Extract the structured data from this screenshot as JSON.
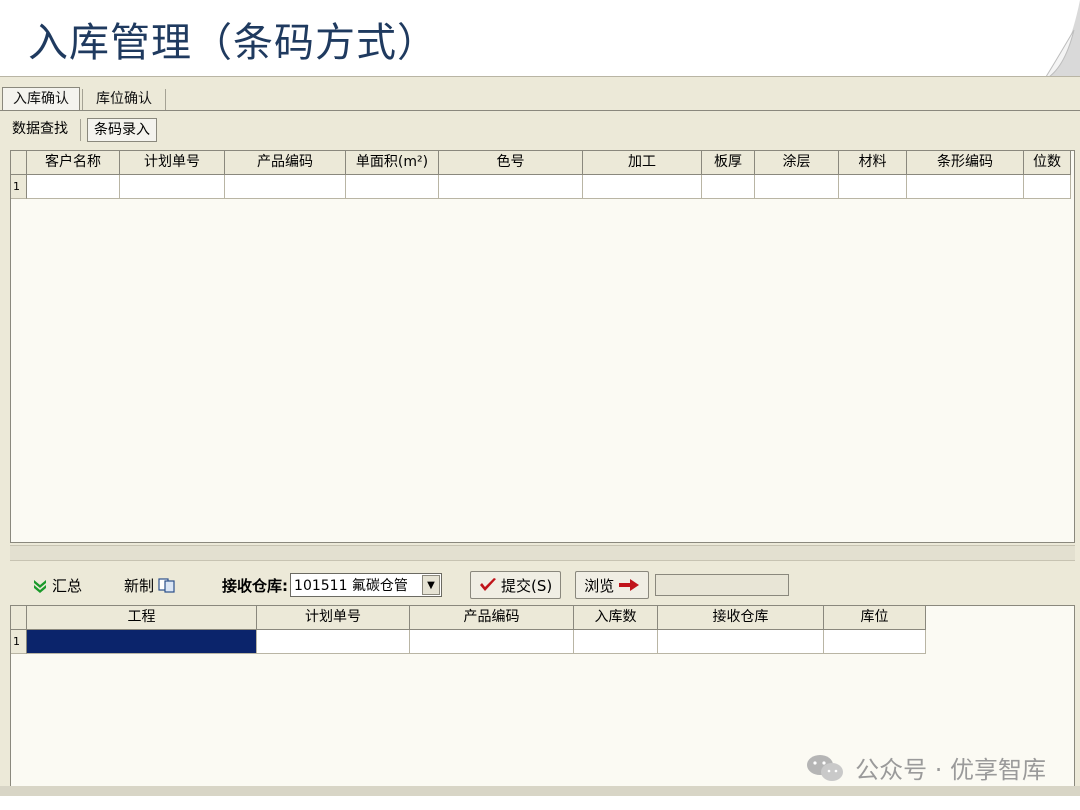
{
  "slide": {
    "title": "入库管理（条码方式）"
  },
  "tabs_primary": [
    {
      "label": "入库确认",
      "active": true
    },
    {
      "label": "库位确认",
      "active": false
    }
  ],
  "tabs_secondary": [
    {
      "label": "数据查找",
      "active": false
    },
    {
      "label": "条码录入",
      "active": true
    }
  ],
  "upper_grid": {
    "columns": [
      "客户名称",
      "计划单号",
      "产品编码",
      "单面积(m²)",
      "色号",
      "加工",
      "板厚",
      "涂层",
      "材料",
      "条形编码",
      "位数"
    ],
    "rows": [
      {
        "num": "1",
        "cells": [
          "",
          "",
          "",
          "",
          "",
          "",
          "",
          "",
          "",
          "",
          ""
        ]
      }
    ]
  },
  "toolbar": {
    "summary_label": "汇总",
    "new_label": "新制",
    "warehouse_label": "接收仓库:",
    "warehouse_value": "101511  氟碳仓管",
    "submit_label": "提交(S)",
    "browse_label": "浏览"
  },
  "lower_grid": {
    "columns": [
      "工程",
      "计划单号",
      "产品编码",
      "入库数",
      "接收仓库",
      "库位"
    ],
    "rows": [
      {
        "num": "1",
        "cells": [
          "",
          "",
          "",
          "",
          "",
          ""
        ]
      }
    ]
  },
  "watermark": {
    "text": "公众号 · 优享智库"
  },
  "colors": {
    "title": "#1f3a5f",
    "window_bg": "#ece9d8",
    "selection": "#0b246b",
    "summary_icon": "#1a9a2a",
    "submit_check": "#c0141b",
    "browse_arrow": "#c0141b"
  }
}
